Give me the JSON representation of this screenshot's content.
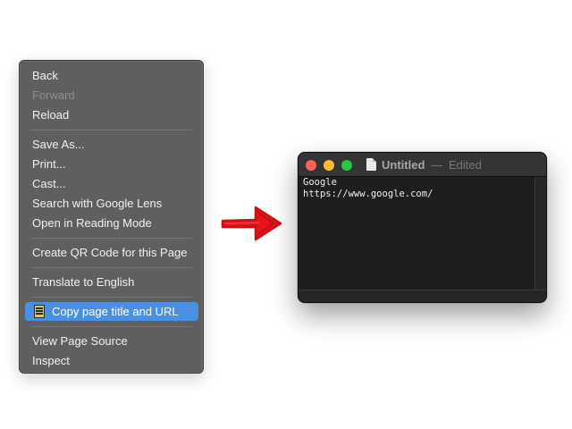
{
  "context_menu": {
    "items": {
      "back": "Back",
      "forward": "Forward",
      "reload": "Reload",
      "save_as": "Save As...",
      "print": "Print...",
      "cast": "Cast...",
      "search_lens": "Search with Google Lens",
      "reading_mode": "Open in Reading Mode",
      "qr_code": "Create QR Code for this Page",
      "translate": "Translate to English",
      "copy_title_url": "Copy page title and URL",
      "view_source": "View Page Source",
      "inspect": "Inspect"
    },
    "disabled": [
      "forward"
    ],
    "highlighted": "copy_title_url",
    "highlight_color": "#4a90e2",
    "background_color": "#5f5f5f"
  },
  "arrow": {
    "color": "#e3141b",
    "direction": "right"
  },
  "editor_window": {
    "title": "Untitled",
    "separator": "—",
    "status": "Edited",
    "doc_icon": "document-icon",
    "traffic_lights": [
      "close",
      "minimize",
      "zoom"
    ],
    "lines": [
      "Google",
      "https://www.google.com/"
    ]
  }
}
